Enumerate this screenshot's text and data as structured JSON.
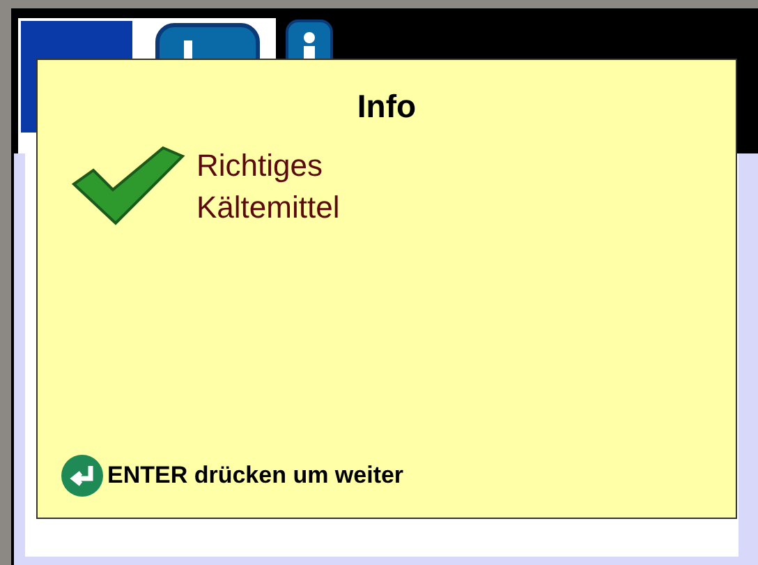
{
  "dialog": {
    "title": "Info",
    "success": true,
    "message": [
      "Richtiges",
      "Kältemittel"
    ],
    "hint": "ENTER drücken um weiter"
  }
}
